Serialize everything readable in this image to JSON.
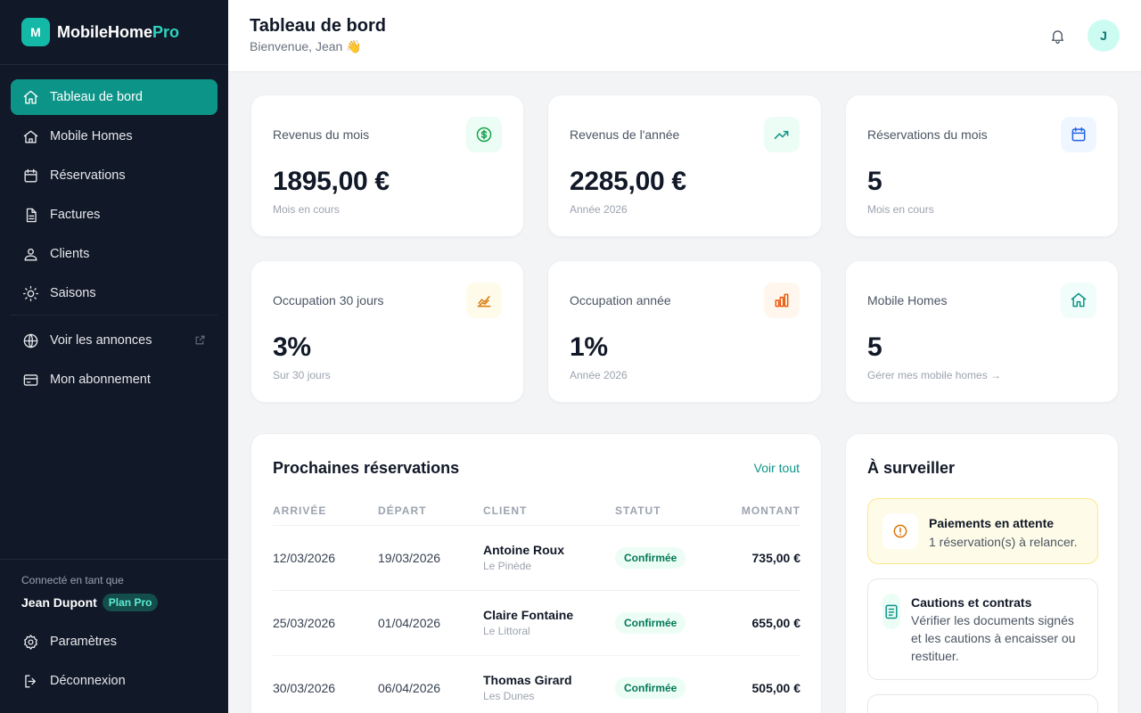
{
  "brand": {
    "logo_letter": "M",
    "name_main": "MobileHome",
    "name_accent": "Pro"
  },
  "sidebar": {
    "items": [
      {
        "label": "Tableau de bord",
        "icon": "home-icon",
        "active": true
      },
      {
        "label": "Mobile Homes",
        "icon": "house-icon"
      },
      {
        "label": "Réservations",
        "icon": "calendar-icon"
      },
      {
        "label": "Factures",
        "icon": "document-icon"
      },
      {
        "label": "Clients",
        "icon": "user-icon"
      },
      {
        "label": "Saisons",
        "icon": "sun-icon"
      }
    ],
    "secondary": [
      {
        "label": "Voir les annonces",
        "icon": "globe-icon",
        "external": true
      },
      {
        "label": "Mon abonnement",
        "icon": "credit-card-icon"
      }
    ],
    "connected_label": "Connecté en tant que",
    "user_name": "Jean Dupont",
    "plan": "Plan Pro",
    "bottom": [
      {
        "label": "Paramètres",
        "icon": "settings-icon"
      },
      {
        "label": "Déconnexion",
        "icon": "logout-icon"
      }
    ]
  },
  "header": {
    "title": "Tableau de bord",
    "subtitle": "Bienvenue, Jean 👋",
    "avatar_letter": "J"
  },
  "stats": [
    {
      "label": "Revenus du mois",
      "value": "1895,00 €",
      "sub": "Mois en cours",
      "icon": "dollar-icon",
      "icon_color": "#16a34a",
      "icon_bg": "#ecfdf5"
    },
    {
      "label": "Revenus de l'année",
      "value": "2285,00 €",
      "sub": "Année 2026",
      "icon": "trending-up-icon",
      "icon_color": "#0d9488",
      "icon_bg": "#ecfdf5"
    },
    {
      "label": "Réservations du mois",
      "value": "5",
      "sub": "Mois en cours",
      "icon": "calendar-icon",
      "icon_color": "#2563eb",
      "icon_bg": "#eff6ff"
    },
    {
      "label": "Occupation 30 jours",
      "value": "3%",
      "sub": "Sur 30 jours",
      "icon": "chart-line-icon",
      "icon_color": "#d97706",
      "icon_bg": "#fffbeb"
    },
    {
      "label": "Occupation année",
      "value": "1%",
      "sub": "Année 2026",
      "icon": "bar-chart-icon",
      "icon_color": "#ea580c",
      "icon_bg": "#fff7ed"
    },
    {
      "label": "Mobile Homes",
      "value": "5",
      "sub": "Gérer mes mobile homes →",
      "icon": "home-icon",
      "icon_color": "#0d9488",
      "icon_bg": "#f0fdfa"
    }
  ],
  "reservations": {
    "title": "Prochaines réservations",
    "see_all": "Voir tout",
    "columns": [
      "ARRIVÉE",
      "DÉPART",
      "CLIENT",
      "STATUT",
      "MONTANT"
    ],
    "rows": [
      {
        "arrival": "12/03/2026",
        "departure": "19/03/2026",
        "client": "Antoine Roux",
        "place": "Le Pinède",
        "status": "Confirmée",
        "amount": "735,00 €"
      },
      {
        "arrival": "25/03/2026",
        "departure": "01/04/2026",
        "client": "Claire Fontaine",
        "place": "Le Littoral",
        "status": "Confirmée",
        "amount": "655,00 €"
      },
      {
        "arrival": "30/03/2026",
        "departure": "06/04/2026",
        "client": "Thomas Girard",
        "place": "Les Dunes",
        "status": "Confirmée",
        "amount": "505,00 €"
      }
    ]
  },
  "watch": {
    "title": "À surveiller",
    "alerts": [
      {
        "title": "Paiements en attente",
        "text": "1 réservation(s) à relancer.",
        "icon": "alert-circle-icon"
      },
      {
        "title": "Cautions et contrats",
        "text_lines": [
          "Vérifier les documents signés",
          "et les cautions à encaisser ou",
          "restituer."
        ],
        "icon": "clipboard-icon"
      }
    ]
  }
}
